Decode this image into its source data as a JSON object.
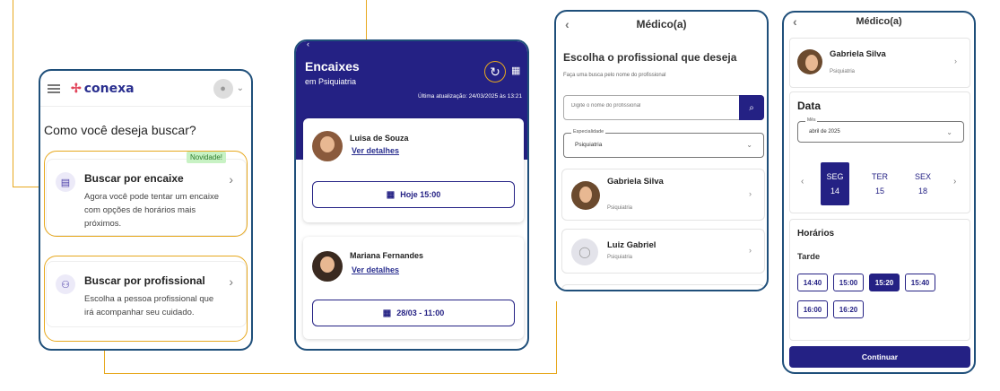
{
  "screen1": {
    "brand": "conexa",
    "title": "Como você deseja buscar?",
    "options": [
      {
        "title": "Buscar por encaixe",
        "badge": "Novidade!",
        "desc": "Agora você pode tentar um encaixe com opções de horários mais próximos."
      },
      {
        "title": "Buscar por profissional",
        "desc": "Escolha a pessoa profissional que irá acompanhar seu cuidado."
      }
    ]
  },
  "screen2": {
    "title": "Encaixes",
    "subtitle": "em Psiquiatria",
    "last_update": "Última atualização: 24/03/2025 às 13:21",
    "cards": [
      {
        "name": "Luisa de Souza",
        "link": "Ver detalhes",
        "slot": "Hoje 15:00"
      },
      {
        "name": "Mariana Fernandes",
        "link": "Ver detalhes",
        "slot": "28/03 - 11:00"
      }
    ]
  },
  "screen3": {
    "header": "Médico(a)",
    "heading": "Escolha o profissional que deseja",
    "hint": "Faça uma busca pelo nome do profissional",
    "search_placeholder": "Digite o nome do profissional",
    "specialty_label": "Especialidade",
    "specialty_value": "Psiquiatria",
    "professionals": [
      {
        "name": "Gabriela Silva",
        "specialty": "Psiquiatria"
      },
      {
        "name": "Luiz Gabriel",
        "specialty": "Psiquiatria"
      }
    ]
  },
  "screen4": {
    "header": "Médico(a)",
    "selected": {
      "name": "Gabriela Silva",
      "specialty": "Psiquiatria"
    },
    "date_title": "Data",
    "month_label": "Mês",
    "month_value": "abril de 2025",
    "days": [
      {
        "dow": "SEG",
        "num": "14",
        "selected": true
      },
      {
        "dow": "TER",
        "num": "15",
        "selected": false
      },
      {
        "dow": "SEX",
        "num": "18",
        "selected": false
      }
    ],
    "times_title": "Horários",
    "period": "Tarde",
    "slots": [
      "14:40",
      "15:00",
      "15:20",
      "15:40",
      "16:00",
      "16:20"
    ],
    "selected_slot": "15:20",
    "continue_label": "Continuar"
  },
  "colors": {
    "primary": "#242184",
    "accent": "#e7a81e",
    "frame": "#1f4f7a"
  }
}
